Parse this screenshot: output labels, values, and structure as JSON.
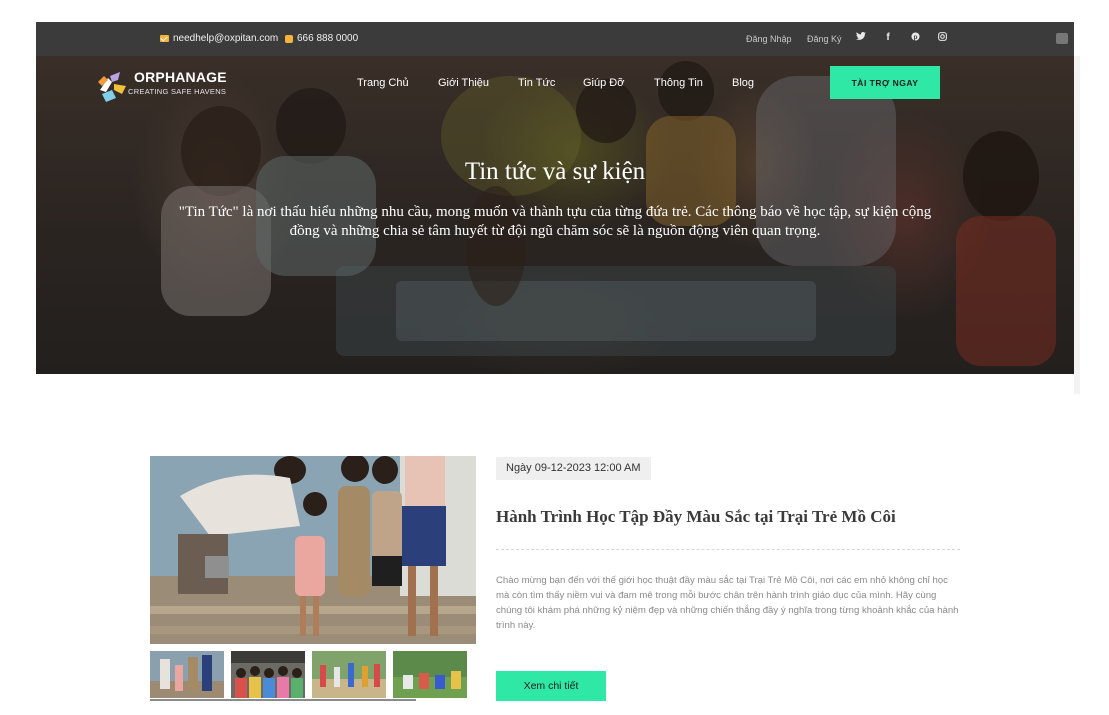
{
  "topbar": {
    "email": "needhelp@oxpitan.com",
    "phone": "666 888 0000",
    "login": "Đăng Nhập",
    "register": "Đăng Ký",
    "social_icons": [
      "twitter-icon",
      "facebook-icon",
      "pinterest-icon",
      "instagram-icon"
    ]
  },
  "logo": {
    "name": "ORPHANAGE",
    "tagline": "CREATING SAFE HAVENS"
  },
  "nav": {
    "items": [
      "Trang Chủ",
      "Giới Thiệu",
      "Tin Tức",
      "Giúp Đỡ",
      "Thông Tin",
      "Blog"
    ],
    "donate": "TÀI TRỢ NGAY"
  },
  "hero": {
    "title": "Tin tức và sự kiện",
    "description": "\"Tin Tức\" là nơi thấu hiểu những nhu cầu, mong muốn và thành tựu của từng đứa trẻ. Các thông báo về học tập, sự kiện cộng đồng và những chia sẻ tâm huyết từ đội ngũ chăm sóc sẽ là nguồn động viên quan trọng."
  },
  "post": {
    "date": "Ngày 09-12-2023 12:00 AM",
    "title": "Hành Trình Học Tập Đầy Màu Sắc tại Trại Trẻ Mồ Côi",
    "excerpt": "Chào mừng bạn đến với thế giới học thuật đầy màu sắc tại Trại Trẻ Mồ Côi, nơi các em nhỏ không chỉ học mà còn tìm thấy niềm vui và đam mê trong mỗi bước chân trên hành trình giáo dục của mình. Hãy cùng chúng tôi khám phá những kỷ niệm đẹp và những chiến thắng đầy ý nghĩa trong từng khoảnh khắc của hành trình này.",
    "button": "Xem chi tiết"
  },
  "colors": {
    "accent": "#2fe8a6",
    "topbar": "#3b3b3b",
    "icon_orange": "#f7b23b"
  }
}
